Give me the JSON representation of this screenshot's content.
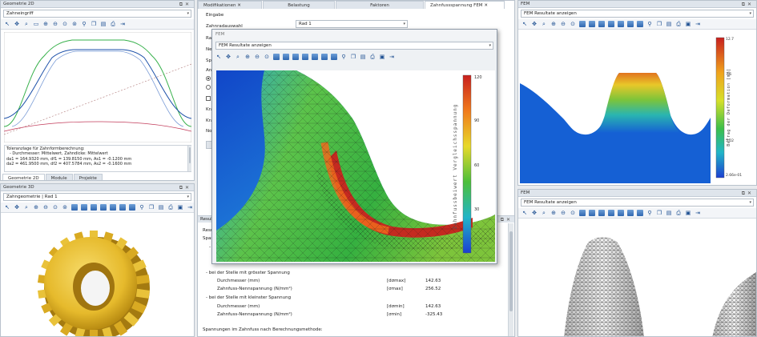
{
  "left_top": {
    "title": "Geometrie 2D",
    "combo": "Zahneingriff",
    "tolerance": {
      "heading": "Toleranzlage für Zahnformberechnung:",
      "line1": "- Durchmesser: Mittelwert, Zahndicke: Mittelwert",
      "line2": "da1 = 164.9320 mm, df1 = 139.8150 mm, As1 = -0.1200 mm",
      "line3": "da2 = 461.9500 mm, df2 = 407.5784 mm, As2 = -0.1600 mm"
    },
    "tabs": [
      "Geometrie 2D",
      "Module",
      "Projekte"
    ]
  },
  "left_bottom": {
    "title": "Geometrie 3D",
    "combo": "Zahngeometrie | Rad 1"
  },
  "middle": {
    "tabs": [
      "Modifikationen",
      "Belastung",
      "Faktoren",
      "Zahnfussspannung FEM"
    ],
    "input_heading": "Eingabe",
    "zahnradauswahl_label": "Zahnradauswahl",
    "zahnradauswahl_value": "Rad 1",
    "truncated_labels": [
      "Rad",
      "Net",
      "Spa",
      "Ans",
      "Kra",
      "Kra",
      "Nor"
    ],
    "results_title": "Resultate",
    "results_side": [
      "Resu",
      "Span",
      "- E"
    ],
    "results": {
      "max_heading": "- bei der Stelle mit grösster Spannung",
      "max_rows": [
        {
          "label": "Durchmesser (mm)",
          "sym": "[dσmax]",
          "value": "142.63"
        },
        {
          "label": "Zahnfuss-Nennspannung (N/mm²)",
          "sym": "[σmax]",
          "value": "256.52"
        }
      ],
      "min_heading": "- bei der Stelle mit kleinster Spannung",
      "min_rows": [
        {
          "label": "Durchmesser (mm)",
          "sym": "[dσmin]",
          "value": "142.63"
        },
        {
          "label": "Zahnfuss-Nennspannung (N/mm²)",
          "sym": "[σmin]",
          "value": "-325.43"
        }
      ],
      "footer": "Spannungen im Zahnfuss nach Berechnungsmethode:"
    }
  },
  "fem_popup": {
    "title": "FEM",
    "combo": "FEM Resultate anzeigen",
    "legend_title": "Zahnfussbeiwert Vergleichsspannung",
    "legend_ticks": [
      "120",
      "90",
      "60",
      "30"
    ]
  },
  "right_top": {
    "title": "FEM",
    "combo": "FEM Resultate anzeigen",
    "legend_title": "Betrag der Deformation [mm]",
    "legend_ticks": [
      "12.7",
      "7.6",
      "5.02",
      "2.66e-01"
    ]
  },
  "right_bottom": {
    "title": "FEM",
    "combo": "FEM Resultate anzeigen"
  },
  "icons": [
    "pointer-icon",
    "move-icon",
    "zoom-window-icon",
    "zoom-in-icon",
    "zoom-out-icon",
    "zoom-fit-icon",
    "view-cube-icon",
    "light-icon",
    "copy-icon",
    "print-icon",
    "save-icon",
    "export-icon"
  ],
  "colors": {
    "accent": "#1d4f91",
    "title_bar": "#dfe5ec",
    "gear_gold": "#e9c23a",
    "fem_blue": "#1560d4",
    "fem_red": "#c8201e"
  }
}
